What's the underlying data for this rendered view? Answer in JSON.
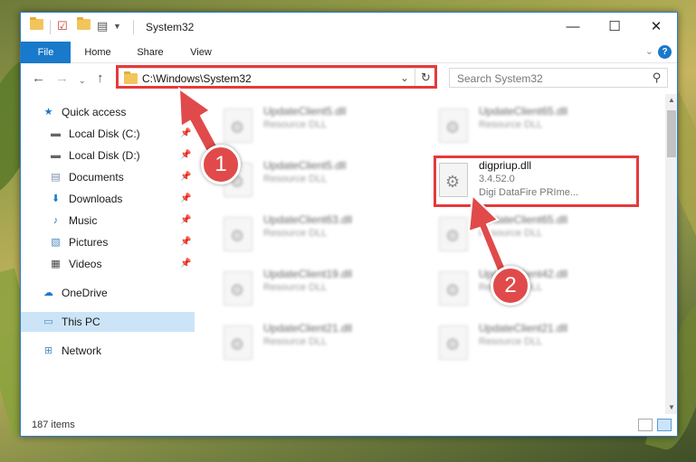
{
  "window": {
    "title": "System32",
    "controls": {
      "minimize": "—",
      "maximize": "☐",
      "close": "✕"
    }
  },
  "ribbon": {
    "tabs": [
      {
        "label": "File"
      },
      {
        "label": "Home"
      },
      {
        "label": "Share"
      },
      {
        "label": "View"
      }
    ],
    "help": "?"
  },
  "address": {
    "path": "C:\\Windows\\System32",
    "search_placeholder": "Search System32"
  },
  "sidebar": {
    "items": [
      {
        "label": "Quick access",
        "icon": "star-icon"
      },
      {
        "label": "Local Disk (C:)",
        "icon": "drive-icon",
        "pinned": true
      },
      {
        "label": "Local Disk (D:)",
        "icon": "drive-icon",
        "pinned": true
      },
      {
        "label": "Documents",
        "icon": "document-icon",
        "pinned": true
      },
      {
        "label": "Downloads",
        "icon": "download-icon",
        "pinned": true
      },
      {
        "label": "Music",
        "icon": "music-icon",
        "pinned": true
      },
      {
        "label": "Pictures",
        "icon": "picture-icon",
        "pinned": true
      },
      {
        "label": "Videos",
        "icon": "video-icon",
        "pinned": true
      },
      {
        "label": "OneDrive",
        "icon": "cloud-icon"
      },
      {
        "label": "This PC",
        "icon": "computer-icon",
        "selected": true
      },
      {
        "label": "Network",
        "icon": "network-icon"
      }
    ]
  },
  "files": [
    {
      "name": "UpdateClient5.dll",
      "type": "Resource DLL",
      "blurred": true
    },
    {
      "name": "UpdateClient65.dll",
      "type": "Resource DLL",
      "blurred": true
    },
    {
      "name": "UpdateClient5.dll",
      "type": "Resource DLL",
      "blurred": true
    },
    {
      "name": "digpriup.dll",
      "version": "3.4.52.0",
      "company": "Digi DataFire PRIme...",
      "blurred": false
    },
    {
      "name": "UpdateClient63.dll",
      "type": "Resource DLL",
      "blurred": true
    },
    {
      "name": "UpdateClient65.dll",
      "type": "Resource DLL",
      "blurred": true
    },
    {
      "name": "UpdateClient19.dll",
      "type": "Resource DLL",
      "blurred": true
    },
    {
      "name": "UpdateClient42.dll",
      "type": "Resource DLL",
      "blurred": true
    },
    {
      "name": "UpdateClient21.dll",
      "type": "Resource DLL",
      "blurred": true
    },
    {
      "name": "UpdateClient21.dll",
      "type": "Resource DLL",
      "blurred": true
    }
  ],
  "status": {
    "items": "187 items"
  },
  "annotations": {
    "step1": "1",
    "step2": "2",
    "color": "#e04a4a"
  }
}
